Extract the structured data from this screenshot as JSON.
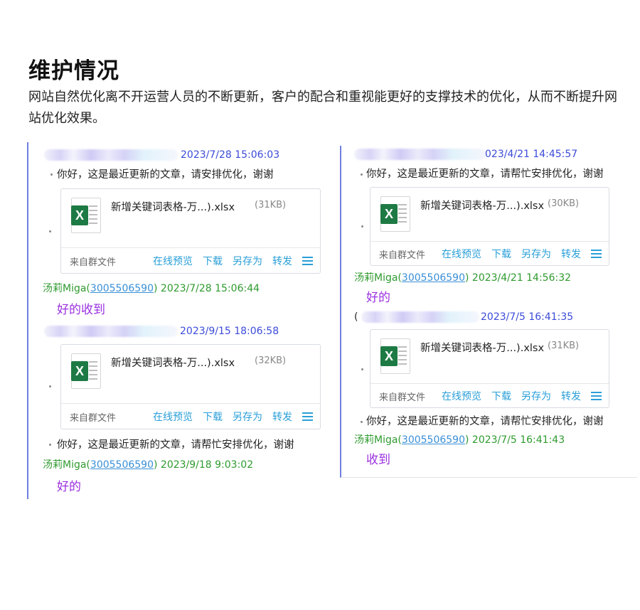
{
  "page": {
    "title": "维护情况",
    "description": "网站自然优化离不开运营人员的不断更新，客户的配合和重视能更好的支撑技术的优化，从而不断提升网站优化效果。"
  },
  "file_card_labels": {
    "source": "来自群文件",
    "preview": "在线预览",
    "download": "下载",
    "save_as": "另存为",
    "forward": "转发"
  },
  "sender": {
    "name": "汤莉Miga(",
    "qq": "3005506590",
    "close": ")"
  },
  "left": {
    "msg1_time": "2023/7/28 15:06:03",
    "msg1_text": "你好，这是最近更新的文章，请安排优化，谢谢",
    "file1_name": "新增关键词表格-万...).xlsx",
    "file1_size": "(31KB)",
    "reply1_time": "2023/7/28 15:06:44",
    "reply1_text": "好的收到",
    "msg2_time": "2023/9/15 18:06:58",
    "file2_name": "新增关键词表格-万...).xlsx",
    "file2_size": "(32KB)",
    "msg2_text": "你好，这是最近更新的文章，请帮忙安排优化，谢谢",
    "reply2_time": "2023/9/18 9:03:02",
    "reply2_text": "好的"
  },
  "right": {
    "msg1_time": "023/4/21 14:45:57",
    "msg1_text": "你好，这是最近更新的文章，请帮忙安排优化，谢谢",
    "file1_name": "新增关键词表格-万...).xlsx",
    "file1_size": "(30KB)",
    "reply1_time": "2023/4/21 14:56:32",
    "reply1_text": "好的",
    "msg2_prefix": "(",
    "msg2_time": "2023/7/5 16:41:35",
    "file2_name": "新增关键词表格-万...).xlsx",
    "file2_size": "(31KB)",
    "msg2_text": "你好，这是最近更新的文章，请帮忙安排优化，谢谢",
    "reply2_time": "2023/7/5 16:41:43",
    "reply2_text": "收到"
  },
  "icons": {
    "excel": "excel-file-icon",
    "menu": "menu-icon"
  },
  "colors": {
    "panel_border": "#6f7fe0",
    "timestamp_blue": "#3b4bd8",
    "sender_green": "#2f9a2f",
    "reply_purple": "#9b2fe0",
    "action_blue": "#2a9fd8",
    "excel_green": "#1e7a44"
  }
}
